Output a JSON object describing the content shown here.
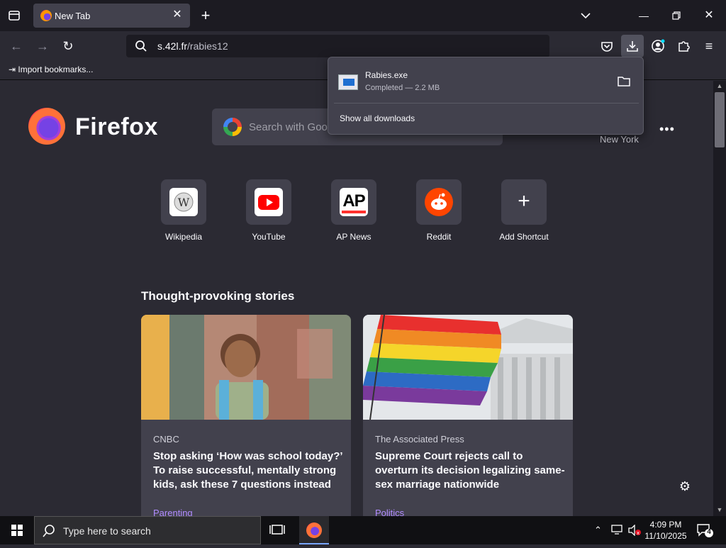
{
  "tabs": [
    {
      "title": "New Tab"
    }
  ],
  "navbar": {
    "url_prefix": "s.42l.fr",
    "url_path": "/rabies12"
  },
  "bookmarks": {
    "import_label": "Import bookmarks..."
  },
  "newtab": {
    "logo_text": "Firefox",
    "search_placeholder": "Search with Goog",
    "weather_location": "New York",
    "shortcuts": [
      {
        "label": "Wikipedia"
      },
      {
        "label": "YouTube"
      },
      {
        "label": "AP News",
        "logo_text": "AP"
      },
      {
        "label": "Reddit"
      },
      {
        "label": "Add Shortcut"
      }
    ],
    "stories_heading": "Thought-provoking stories",
    "stories": [
      {
        "source": "CNBC",
        "title": "Stop asking ‘How was school today?’ To raise successful, mentally strong kids, ask these 7 questions instead",
        "category": "Parenting"
      },
      {
        "source": "The Associated Press",
        "title": "Supreme Court rejects call to overturn its decision legalizing same-sex marriage nationwide",
        "category": "Politics"
      }
    ]
  },
  "downloads": {
    "file_name": "Rabies.exe",
    "status": "Completed — 2.2 MB",
    "show_all": "Show all downloads"
  },
  "taskbar": {
    "search_placeholder": "Type here to search",
    "time": "4:09 PM",
    "date": "11/10/2025",
    "notification_count": "4"
  },
  "colors": {
    "accent": "#7542e5",
    "category": "#b18cff",
    "chrome_dark": "#1c1b22",
    "chrome": "#2b2a33",
    "card": "#42414d"
  }
}
